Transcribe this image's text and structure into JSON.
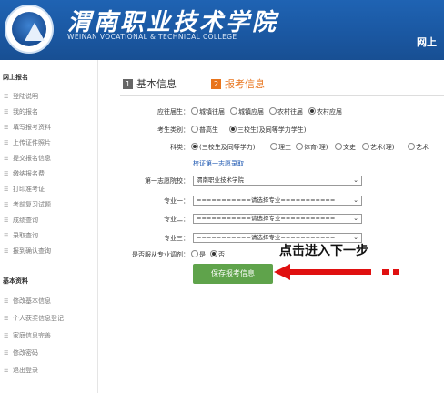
{
  "header": {
    "school_name_cn": "渭南职业技术学院",
    "school_name_en": "WEINAN VOCATIONAL & TECHNICAL COLLEGE",
    "right_text": "网上"
  },
  "sidebar": {
    "section1_title": "网上报名",
    "section1_items": [
      {
        "label": "登陆说明"
      },
      {
        "label": "我的报名"
      },
      {
        "label": "填写报考资料"
      },
      {
        "label": "上传证件照片"
      },
      {
        "label": "提交报名信息"
      },
      {
        "label": "缴纳报名费"
      },
      {
        "label": "打印准考证"
      },
      {
        "label": "考前复习试题"
      },
      {
        "label": "成绩查询"
      },
      {
        "label": "录取查询"
      },
      {
        "label": "报到确认查询"
      }
    ],
    "section2_title": "基本资料",
    "section2_items": [
      {
        "label": "修改基本信息"
      },
      {
        "label": "个人获奖信息登记"
      },
      {
        "label": "家庭信息完善"
      },
      {
        "label": "修改密码"
      },
      {
        "label": "退出登录"
      }
    ]
  },
  "tabs": [
    {
      "num": "1",
      "label": "基本信息"
    },
    {
      "num": "2",
      "label": "报考信息"
    }
  ],
  "form": {
    "hukou_label": "应往届生：",
    "hukou_options": [
      "城镇往届",
      "城镇应届",
      "农村往届",
      "农村应届"
    ],
    "hukou_selected": "农村应届",
    "kslb_label": "考生类别：",
    "kslb_options": [
      "普高生",
      "三校生(及同等学力学生)"
    ],
    "kslb_selected": "三校生(及同等学力学生)",
    "kelei_label": "科类：",
    "kelei_options": [
      "(三校生及同等学力)",
      "理工",
      "体育(理)",
      "文史",
      "艺术(理)",
      "艺术"
    ],
    "kelei_selected": "(三校生及同等学力)",
    "link_text": "校证第一志愿录取",
    "zhiyuan_label": "第一志愿院校：",
    "zhiyuan_value": "渭南职业技术学院",
    "major1_label": "专业一：",
    "major2_label": "专业二：",
    "major3_label": "专业三：",
    "major_placeholder": "===========请选择专业===========",
    "tiaoji_label": "是否服从专业调剂：",
    "tiaoji_options": [
      "是",
      "否"
    ],
    "tiaoji_selected": "否",
    "save_button": "保存报考信息"
  },
  "annotation": {
    "text": "点击进入下一步",
    "arrow_color": "#e01010"
  },
  "colors": {
    "header_blue": "#1a57a1",
    "accent_orange": "#e8741c",
    "button_green": "#5fa34b",
    "link_blue": "#1a55b0"
  }
}
